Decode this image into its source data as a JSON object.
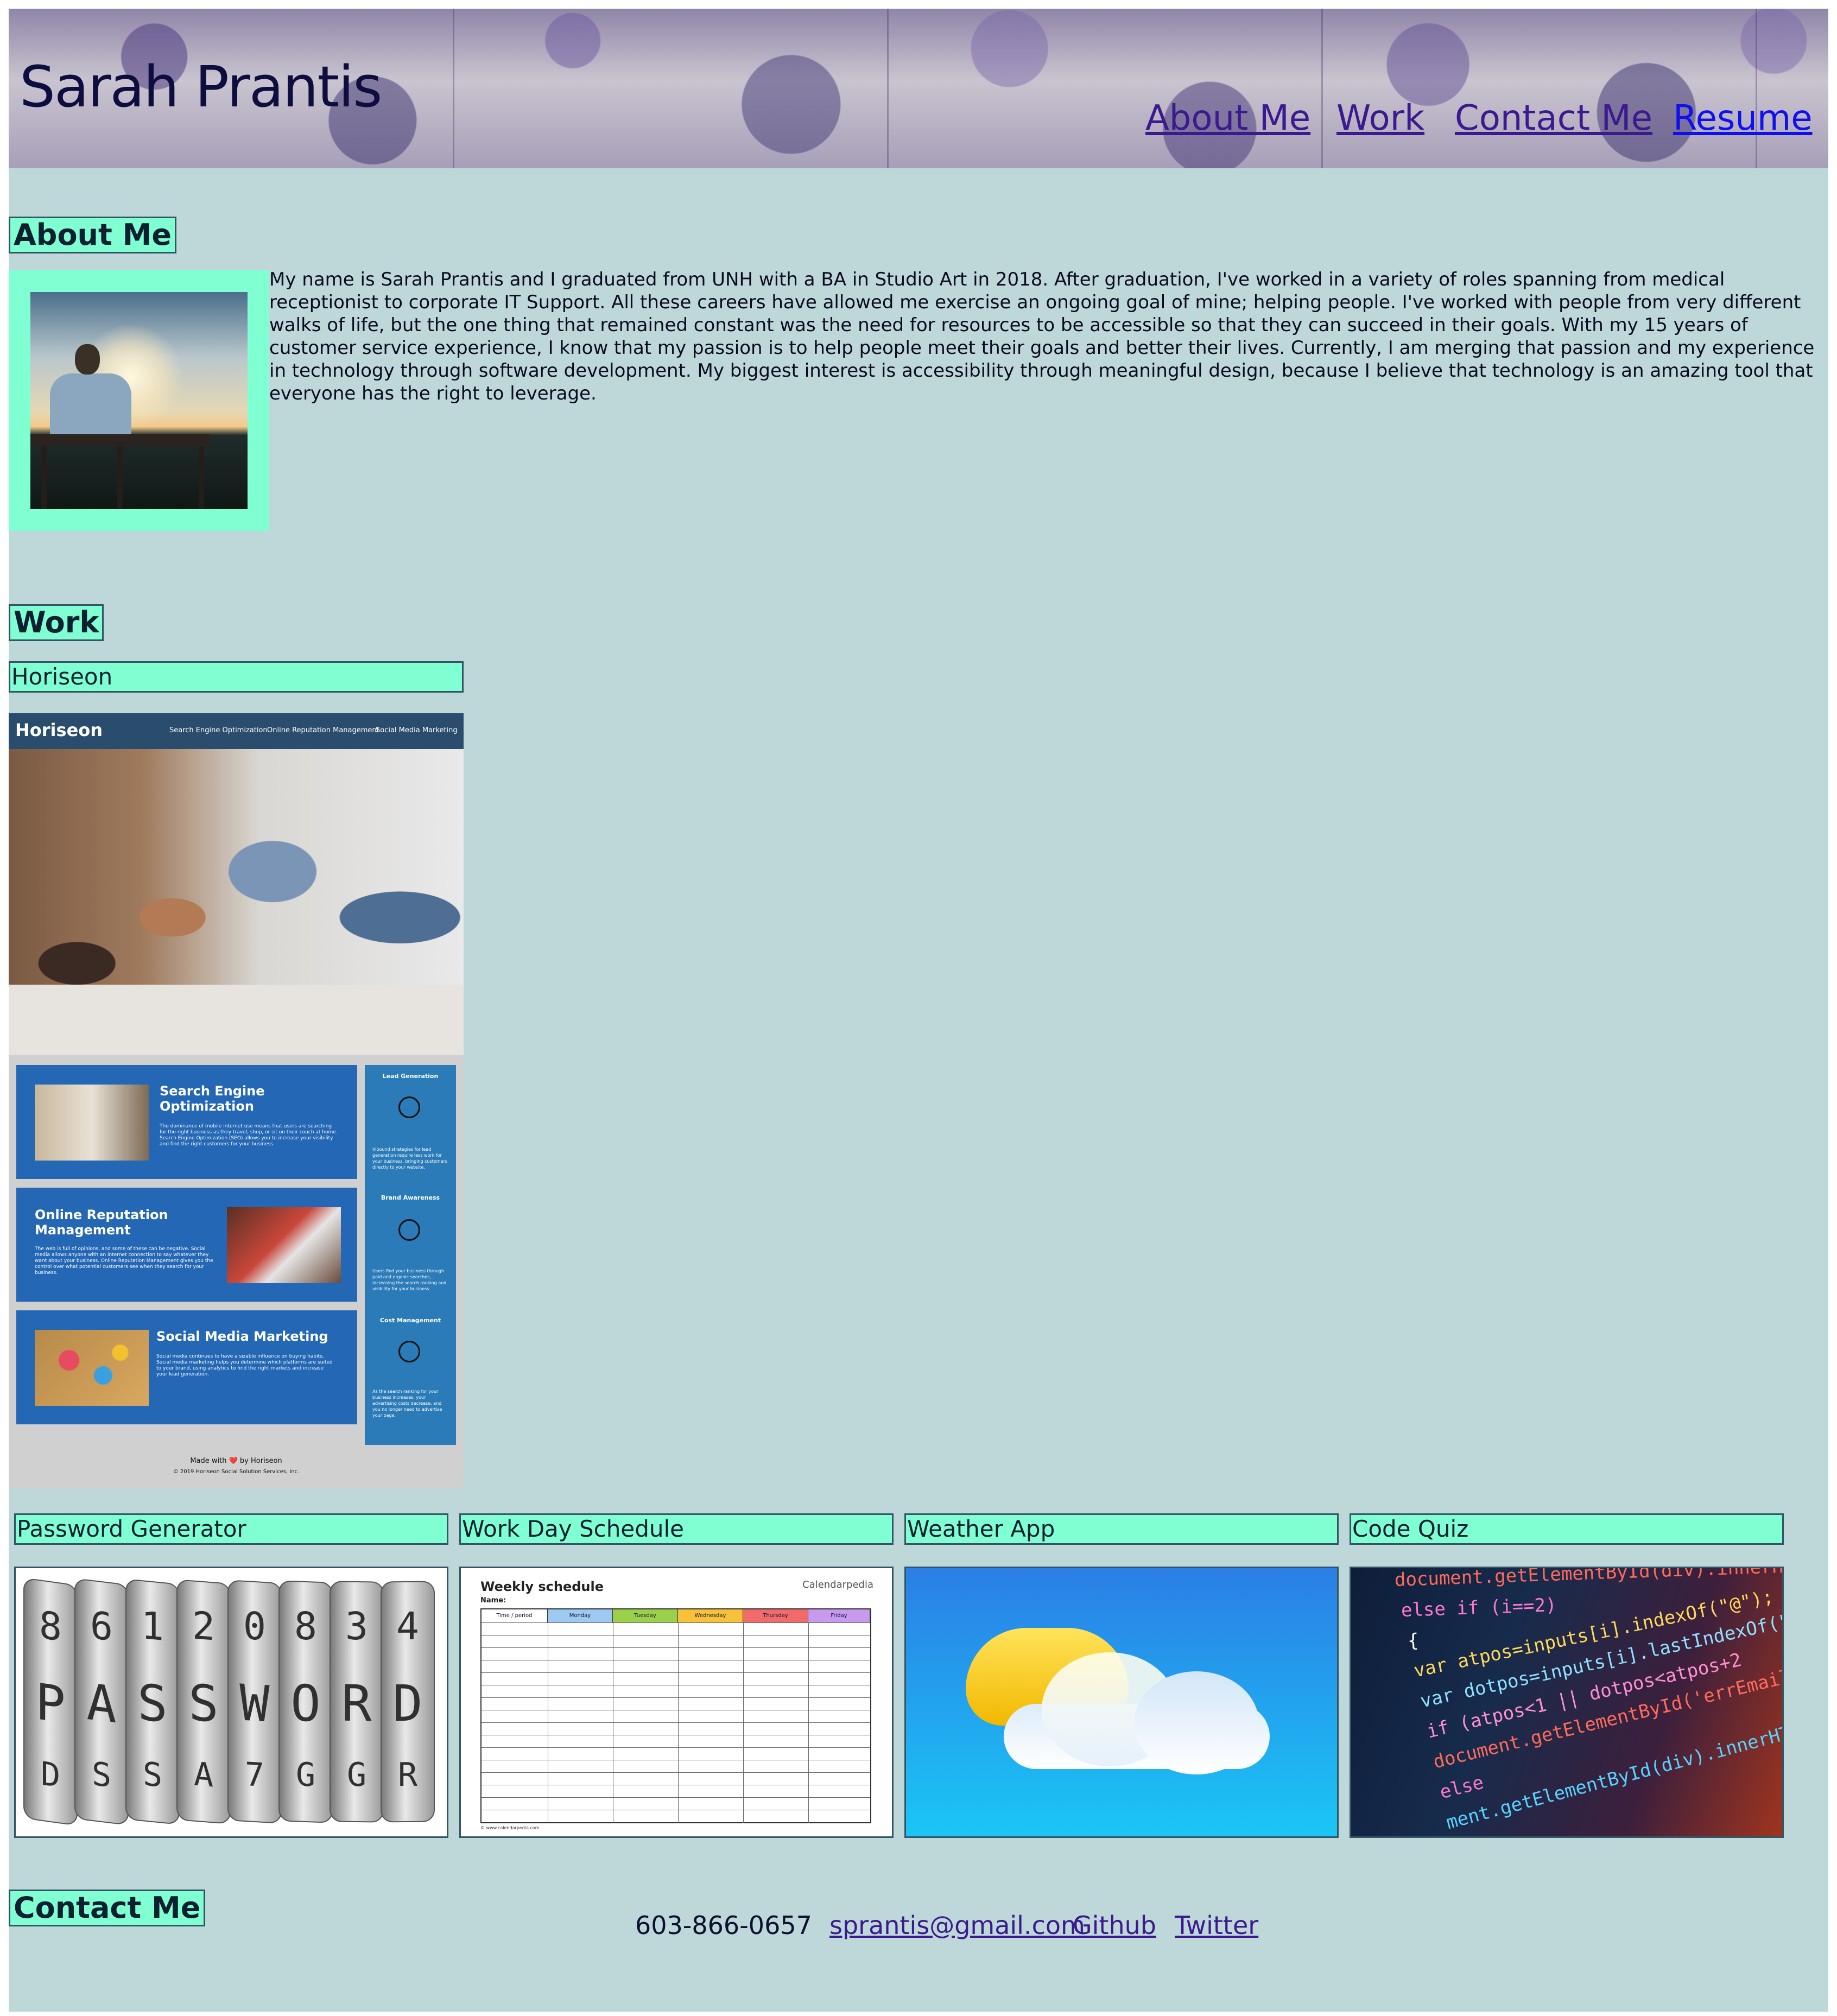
{
  "header": {
    "title": "Sarah Prantis",
    "nav": [
      "About Me",
      "Work",
      "Contact Me",
      "Resume"
    ]
  },
  "about": {
    "heading": "About Me",
    "photo_alt": "Sarah standing on a deck at sunset",
    "text": "My name is Sarah Prantis and I graduated from UNH with a BA in Studio Art in 2018. After graduation, I've worked in a variety of roles spanning from medical receptionist to corporate IT Support. All these careers have allowed me exercise an ongoing goal of mine; helping people. I've worked with people from very different walks of life, but the one thing that remained constant was the need for resources to be accessible so that they can succeed in their goals. With my 15 years of customer service experience, I know that my passion is to help people meet their goals and better their lives. Currently, I am merging that passion and my experience in technology through software development. My biggest interest is accessibility through meaningful design, because I believe that technology is an amazing tool that everyone has the right to leverage."
  },
  "work": {
    "heading": "Work",
    "featured": {
      "title": "Horiseon",
      "screenshot": {
        "logo": "Horiseon",
        "nav": [
          "Search Engine Optimization",
          "Online Reputation Management",
          "Social Media Marketing"
        ],
        "boxes": [
          {
            "title": "Search Engine Optimization",
            "text": "The dominance of mobile internet use means that users are searching for the right business as they travel, shop, or sit on their couch at home. Search Engine Optimization (SEO) allows you to increase your visibility and find the right customers for your business."
          },
          {
            "title": "Online Reputation Management",
            "text": "The web is full of opinions, and some of these can be negative. Social media allows anyone with an internet connection to say whatever they want about your business. Online Reputation Management gives you the control over what potential customers see when they search for your business."
          },
          {
            "title": "Social Media Marketing",
            "text": "Social media continues to have a sizable influence on buying habits. Social media marketing helps you determine which platforms are suited to your brand, using analytics to find the right markets and increase your lead generation."
          }
        ],
        "sidebar": [
          {
            "title": "Lead Generation",
            "text": "Inbound strategies for lead generation require less work for your business, bringing customers directly to your website."
          },
          {
            "title": "Brand Awareness",
            "text": "Users find your business through paid and organic searches, increasing the search ranking and visibility for your business."
          },
          {
            "title": "Cost Management",
            "text": "As the search ranking for your business increases, your advertising costs decrease, and you no longer need to advertise your page."
          }
        ],
        "footer": "Made with ❤️ by Horiseon",
        "copyright": "© 2019 Horiseon Social Solution Services, Inc."
      }
    },
    "projects": [
      {
        "title": "Password Generator"
      },
      {
        "title": "Work Day Schedule",
        "image": {
          "title": "Weekly schedule",
          "name_label": "Name:",
          "brand": "Calendarpedia",
          "columns": [
            "Time / period",
            "Monday",
            "Tuesday",
            "Wednesday",
            "Thursday",
            "Friday"
          ],
          "column_colors": [
            "#ffffff",
            "#9ec9f2",
            "#9bd14a",
            "#f7c23a",
            "#f26b6b",
            "#c79af0"
          ],
          "footer": "© www.calendarpedia.com"
        }
      },
      {
        "title": "Weather App"
      },
      {
        "title": "Code Quiz",
        "image": {
          "lines": [
            "document.getElementById(div).innerHTML",
            "else if (i==2)",
            "{",
            "var atpos=inputs[i].indexOf(\"@\");",
            "var dotpos=inputs[i].lastIndexOf(\".\");",
            "if (atpos<1 || dotpos<atpos+2",
            "document.getElementById('errEmail')",
            "else",
            "ment.getElementById(div).innerHTML"
          ]
        }
      }
    ],
    "password_image": {
      "top_row": [
        "8",
        "6",
        "1",
        "2",
        "0",
        "8",
        "3",
        "4"
      ],
      "mid_row": [
        "P",
        "A",
        "S",
        "S",
        "W",
        "O",
        "R",
        "D"
      ],
      "bottom_row": [
        "D",
        "S",
        "S",
        "A",
        "7",
        "G",
        "G",
        "R"
      ]
    }
  },
  "contact": {
    "heading": "Contact Me",
    "phone": "603-866-0657",
    "links": [
      "sprantis@gmail.com",
      "Github",
      "Twitter"
    ]
  },
  "colors": {
    "page_bg": "#bed8d9",
    "accent": "#7fffd2",
    "link": "#3a1a8e",
    "link_active": "#1010ee"
  }
}
